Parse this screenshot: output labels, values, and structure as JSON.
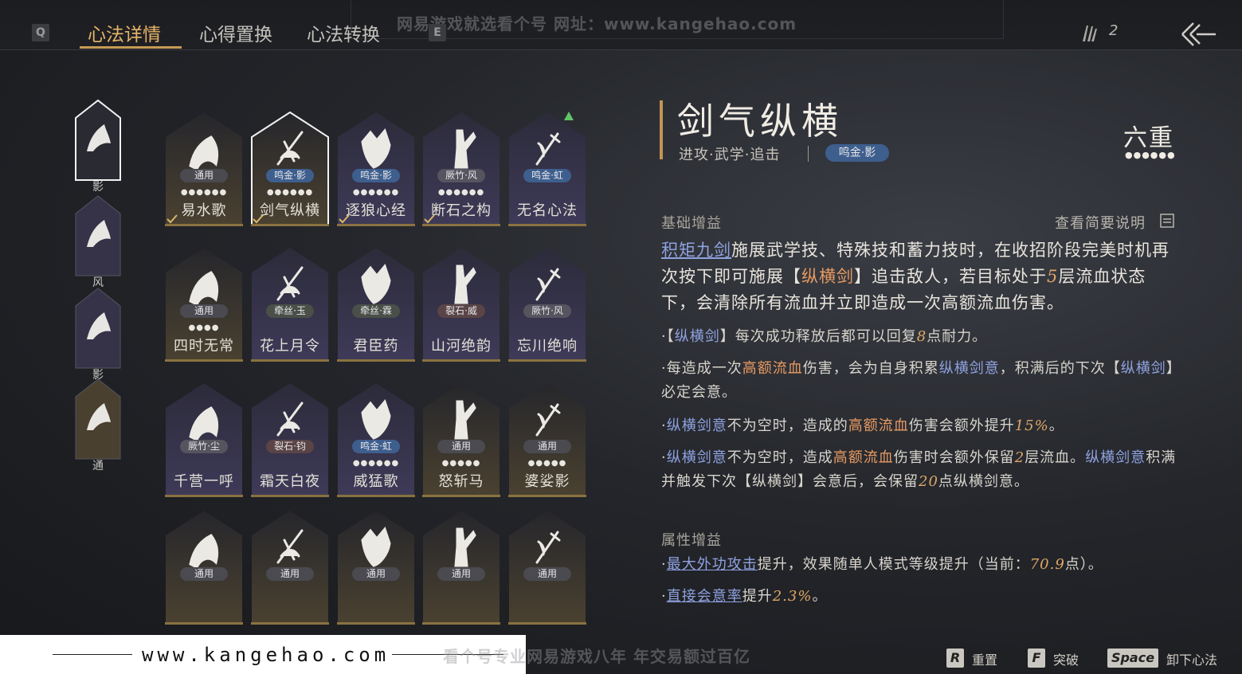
{
  "top": {
    "key_left": "Q",
    "key_right": "E",
    "tabs": [
      "心法详情",
      "心得置换",
      "心法转换"
    ],
    "watermark": "网易游戏就选看个号  网址：www.kangehao.com",
    "counter": "2"
  },
  "side_slots": [
    {
      "tag": "影",
      "icon": "archer-bird-icon"
    },
    {
      "tag": "风",
      "icon": "swordsman-icon"
    },
    {
      "tag": "影",
      "icon": "wolf-icon"
    },
    {
      "tag": "通",
      "icon": "horse-icon"
    }
  ],
  "cards": [
    {
      "name": "易水歌",
      "badge": "通用",
      "badge_type": "common",
      "dots": "●●●●●●",
      "equipped": true
    },
    {
      "name": "剑气纵横",
      "badge": "鸣金·影",
      "badge_type": "mingjin",
      "dots": "●●●●●●",
      "equipped": true,
      "selected": true
    },
    {
      "name": "逐狼心经",
      "badge": "鸣金·影",
      "badge_type": "mingjin",
      "dots": "●●●●●●",
      "equipped": true
    },
    {
      "name": "断石之构",
      "badge": "厥竹·风",
      "badge_type": "xianzhu",
      "dots": "●●●●●●",
      "equipped": true
    },
    {
      "name": "无名心法",
      "badge": "鸣金·虹",
      "badge_type": "mingjin",
      "dots": "",
      "upgrade": true
    },
    {
      "name": "四时无常",
      "badge": "通用",
      "badge_type": "common",
      "dots": "●●●●"
    },
    {
      "name": "花上月令",
      "badge": "牵丝·玉",
      "badge_type": "qiansi",
      "dots": ""
    },
    {
      "name": "君臣药",
      "badge": "牵丝·霖",
      "badge_type": "qiansi",
      "dots": ""
    },
    {
      "name": "山河绝韵",
      "badge": "裂石·威",
      "badge_type": "liesh",
      "dots": ""
    },
    {
      "name": "忘川绝响",
      "badge": "厥竹·风",
      "badge_type": "xianzhu",
      "dots": ""
    },
    {
      "name": "千营一呼",
      "badge": "厥竹·尘",
      "badge_type": "xianzhu",
      "dots": ""
    },
    {
      "name": "霜天白夜",
      "badge": "裂石·钧",
      "badge_type": "liesh",
      "dots": ""
    },
    {
      "name": "威猛歌",
      "badge": "鸣金·虹",
      "badge_type": "mingjin",
      "dots": "●●●●●●"
    },
    {
      "name": "怒斩马",
      "badge": "通用",
      "badge_type": "common",
      "dots": "●●●●●"
    },
    {
      "name": "婆娑影",
      "badge": "通用",
      "badge_type": "common",
      "dots": "●●●●●"
    },
    {
      "name": "",
      "badge": "通用",
      "badge_type": "common",
      "dots": ""
    },
    {
      "name": "",
      "badge": "通用",
      "badge_type": "common",
      "dots": ""
    },
    {
      "name": "",
      "badge": "通用",
      "badge_type": "common",
      "dots": ""
    },
    {
      "name": "",
      "badge": "通用",
      "badge_type": "common",
      "dots": ""
    },
    {
      "name": "",
      "badge": "通用",
      "badge_type": "common",
      "dots": ""
    }
  ],
  "detail": {
    "title": "剑气纵横",
    "subtitle": "进攻·武学·追击",
    "badge": "鸣金·影",
    "rank": "六重",
    "rank_dots": "●●●●●●",
    "section_basic": "基础增益",
    "view_brief": "查看简要说明",
    "desc": {
      "link": "积矩九剑",
      "p1": "施展武学技、特殊技和蓄力技时，在收招阶段完美时机再次按下即可施展【",
      "skill": "纵横剑",
      "p2": "】追击敌人，若目标处于",
      "stacks": "5",
      "p3": "层流血状态下，会清除所有流血并立即造成一次高额流血伤害。"
    },
    "bullet1": {
      "a": "·【",
      "b": "纵横剑",
      "c": "】每次成功释放后都可以回复",
      "d": "8",
      "e": "点耐力。"
    },
    "bullet2": {
      "a": "·每造成一次",
      "b": "高额流血",
      "c": "伤害，会为自身积累",
      "d": "纵横剑意",
      "e": "，积满后的下次【",
      "f": "纵横剑",
      "g": "】必定会意。"
    },
    "bullet3": {
      "a": "·",
      "b": "纵横剑意",
      "c": "不为空时，造成的",
      "d": "高额流血",
      "e": "伤害会额外提升",
      "f": "15%",
      "g": "。"
    },
    "bullet4": {
      "a": "·",
      "b": "纵横剑意",
      "c": "不为空时，造成",
      "d": "高额流血",
      "e": "伤害时会额外保留",
      "f": "2",
      "g": "层流血。",
      "h": "纵横剑意",
      "i": "积满并触发下次【纵横剑】会意后，会保留",
      "j": "20",
      "k": "点纵横剑意。"
    },
    "section_attr": "属性增益",
    "attr1": {
      "a": "·",
      "b": "最大外功攻击",
      "c": "提升，效果随单人模式等级提升（当前：",
      "d": "70.9",
      "e": "点）。"
    },
    "attr2": {
      "a": "·",
      "b": "直接会意率",
      "c": "提升",
      "d": "2.3%",
      "e": "。"
    }
  },
  "bottom": {
    "url": "www.kangehao.com",
    "watermark": "看个号专业网易游戏八年  年交易额过百亿",
    "hints": [
      {
        "key": "R",
        "label": "重置"
      },
      {
        "key": "F",
        "label": "突破"
      },
      {
        "key": "Space",
        "label": "卸下心法"
      }
    ]
  },
  "colors": {
    "accent_gold": "#e6b468",
    "link_blue": "#8fa2e0",
    "highlight_orange": "#e89a62",
    "badge_blue": "#3e5f8e"
  }
}
